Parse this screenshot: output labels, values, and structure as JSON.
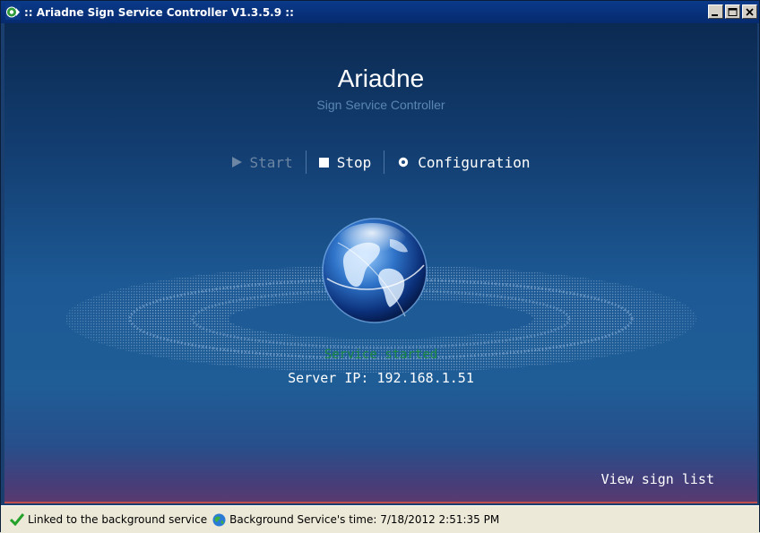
{
  "window": {
    "title": ":: Ariadne Sign Service Controller V1.3.5.9 ::",
    "app_icon": "ariadne-app-icon",
    "buttons": [
      "minimize-icon",
      "maximize-icon",
      "close-icon"
    ]
  },
  "header": {
    "title": "Ariadne",
    "subtitle": "Sign Service Controller"
  },
  "toolbar": {
    "start_label": "Start",
    "stop_label": "Stop",
    "config_label": "Configuration",
    "start_enabled": false
  },
  "main": {
    "status": "Service started",
    "server_ip": "Server IP: 192.168.1.51",
    "view_sign_list": "View sign list"
  },
  "statusbar": {
    "link_status": "Linked to the background service",
    "service_time": "Background Service's time: 7/18/2012 2:51:35 PM"
  },
  "colors": {
    "status_green": "#1d8a43",
    "accent_red": "#c0504d",
    "titlebar_blue": "#0a3a8a"
  }
}
